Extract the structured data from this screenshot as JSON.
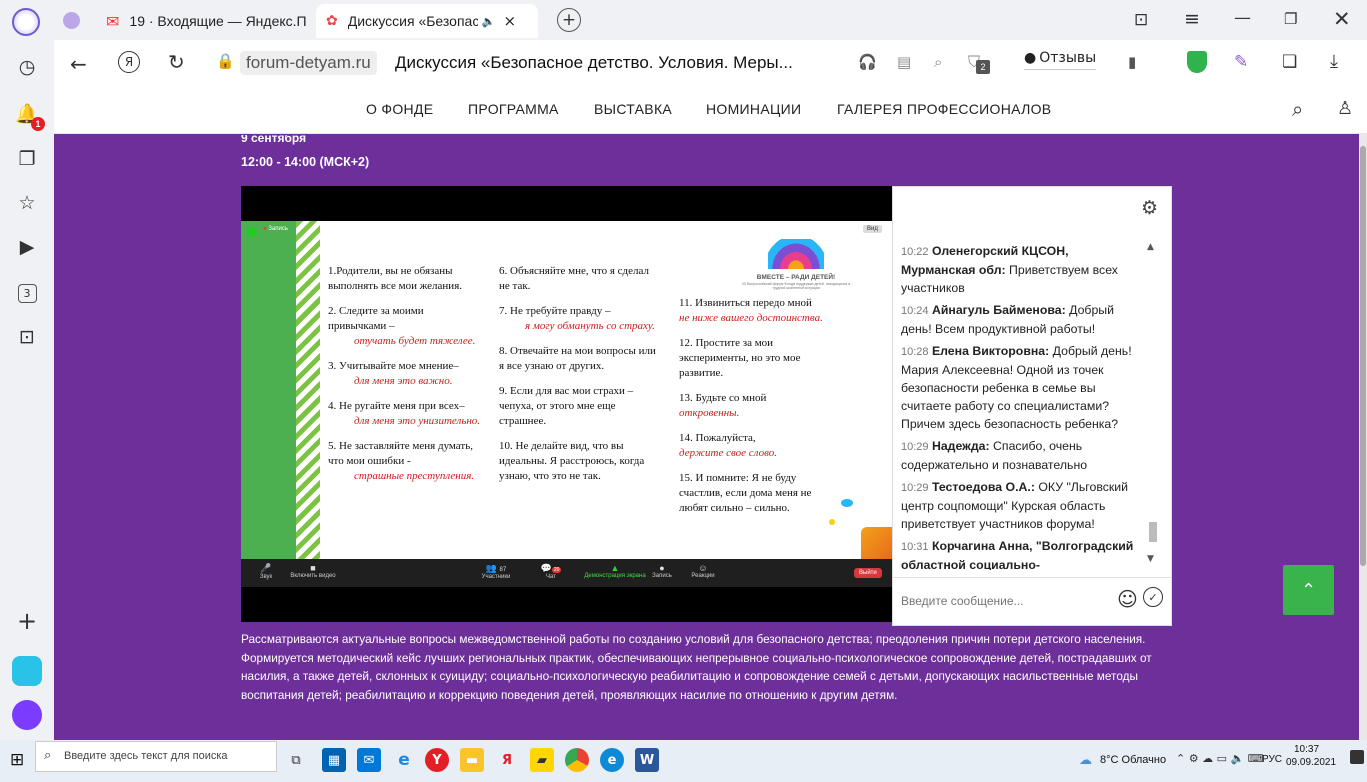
{
  "browser": {
    "tabs": [
      {
        "label": "19 · Входящие — Яндекс.П"
      },
      {
        "label": "Дискуссия «Безопас"
      }
    ],
    "url_domain": "forum-detyam.ru",
    "page_title": "Дискуссия «Безопасное детство. Условия. Меры...",
    "reviews_label": "Отзывы",
    "ext_badge": "2",
    "notif_badge": "1",
    "left_counter": "3"
  },
  "site_nav": {
    "items": [
      "О ФОНДЕ",
      "ПРОГРАММА",
      "ВЫСТАВКА",
      "НОМИНАЦИИ",
      "ГАЛЕРЕЯ ПРОФЕССИОНАЛОВ"
    ]
  },
  "event": {
    "date": "9 сентября",
    "time": "12:00 - 14:00 (МСК+2)"
  },
  "slide": {
    "logo_text": "ВМЕСТЕ – РАДИ ДЕТЕЙ!",
    "logo_sub": "VII Всероссийский форум Фонда поддержки детей, находящихся в трудной жизненной ситуации",
    "rec_label": "Запись",
    "view_label": "Вид",
    "col1": [
      {
        "text": "1.Родители, вы не обязаны выполнять все мои желания.",
        "red": ""
      },
      {
        "text": "2. Следите за моими привычками –",
        "red": "отучать будет тяжелее."
      },
      {
        "text": "3. Учитывайте мое мнение–",
        "red": "для меня это важно."
      },
      {
        "text": "4. Не ругайте меня при всех–",
        "red": "для меня это унизительно."
      },
      {
        "text": "5. Не заставляйте меня думать, что мои ошибки -",
        "red": "страшные преступления."
      }
    ],
    "col2": [
      {
        "text": "6. Объясняйте мне, что я сделал не так.",
        "red": ""
      },
      {
        "text": "7. Не требуйте правду –",
        "red": "я могу обмануть со страху."
      },
      {
        "text": "8. Отвечайте на мои вопросы или я все узнаю от других.",
        "red": ""
      },
      {
        "text": "9. Если для вас мои страхи – чепуха, от этого мне еще страшнее.",
        "red": ""
      },
      {
        "text": "10. Не делайте вид, что вы идеальны. Я расстроюсь, когда узнаю, что это не так.",
        "red": ""
      }
    ],
    "col3": [
      {
        "text": "11. Извиниться передо мной",
        "red": "не ниже вашего достоинства."
      },
      {
        "text": "12. Простите за мои эксперименты, но это мое развитие.",
        "red": ""
      },
      {
        "text": "13. Будьте со мной",
        "red": "откровенны."
      },
      {
        "text": "14. Пожалуйста,",
        "red": "держите свое слово."
      },
      {
        "text": "15. И помните: Я не буду счастлив, если дома меня не любят сильно – сильно.",
        "red": ""
      }
    ]
  },
  "zoom": {
    "sound": "Звук",
    "video": "Включить видео",
    "participants": "Участники",
    "participants_count": "87",
    "chat": "Чат",
    "chat_badge": "20",
    "share": "Демонстрация экрана",
    "record": "Запись",
    "reactions": "Реакции",
    "leave": "Выйти"
  },
  "chat": {
    "messages": [
      {
        "time": "10:22",
        "author": "Оленегорский КЦСОН, Мурманская обл:",
        "text": "Приветствуем всех участников"
      },
      {
        "time": "10:24",
        "author": "Айнагуль Байменова:",
        "text": "Добрый день! Всем продуктивной работы!"
      },
      {
        "time": "10:28",
        "author": "Елена Викторовна:",
        "text": "Добрый день! Мария Алексеевна! Одной из точек безопасности ребенка в семье вы считаете работу со специалистами? Причем здесь безопасность ребенка?"
      },
      {
        "time": "10:29",
        "author": "Надежда:",
        "text": "Спасибо, очень содержательно и познавательно"
      },
      {
        "time": "10:29",
        "author": "Тестоедова О.А.:",
        "text": "ОКУ \"Льговский центр соцпомощи\" Курская область приветствует участников форума!"
      },
      {
        "time": "10:31",
        "author": "Корчагина Анна, \"Волгоградский областной социально-реабилитационный центр для",
        "text": ""
      }
    ],
    "input_placeholder": "Введите сообщение..."
  },
  "description": {
    "p1": "Рассматриваются актуальные вопросы межведомственной работы по созданию условий для безопасного детства; преодоления причин потери детского населения.",
    "p2": "Формируется методический кейс лучших региональных практик, обеспечивающих непрерывное социально-психологическое сопровождение детей, пострадавших от насилия, а также детей, склонных к суициду; социально-психологическую реабилитацию и сопровождение семей с детьми, допускающих насильственные методы воспитания детей; реабилитацию и коррекцию поведения детей, проявляющих насилие по отношению к другим детям."
  },
  "taskbar": {
    "search_placeholder": "Введите здесь текст для поиска",
    "weather": "8°C Облачно",
    "lang": "РУС",
    "time": "10:37",
    "date": "09.09.2021"
  },
  "colors": {
    "purple": "#6d2f99",
    "green_button": "#38b44a",
    "slide_green": "#4caf50"
  }
}
